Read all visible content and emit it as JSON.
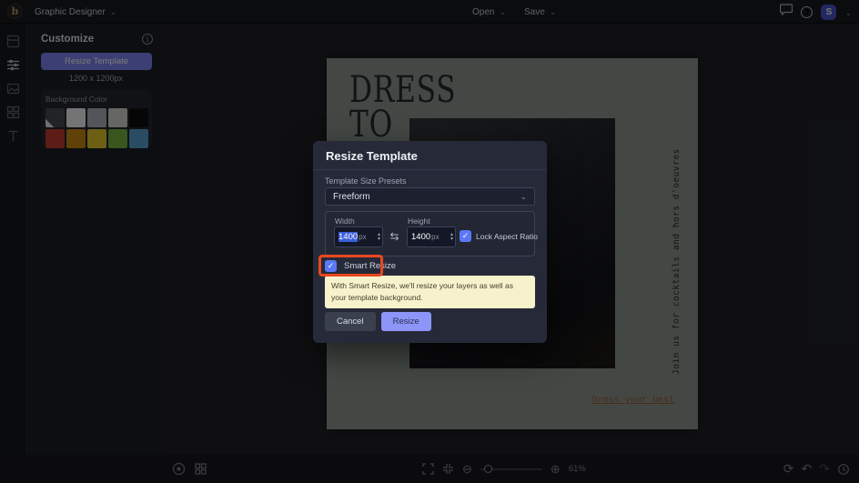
{
  "topbar": {
    "app_menu": "Graphic Designer",
    "open_label": "Open",
    "save_label": "Save",
    "avatar_initial": "S"
  },
  "sidebar": {
    "items": [
      "templates",
      "customize",
      "image-manager",
      "graphics",
      "text"
    ]
  },
  "panel": {
    "title": "Customize",
    "resize_button": "Resize Template",
    "dimensions": "1200 x 1200px",
    "background_color_label": "Background Color",
    "swatches": [
      "transparent",
      "#f2f2f2",
      "#aeb4ba",
      "#d6d6ce",
      "#0d0d0d",
      "#c23b2e",
      "#c98a12",
      "#e3c82a",
      "#78b440",
      "#58a0d0"
    ]
  },
  "canvas": {
    "heading_line1": "DRESS",
    "heading_line2": "TO",
    "vertical_text": "Join us for cocktails and hors d'oeuvres",
    "footer_text": "Dress your best"
  },
  "modal": {
    "title": "Resize Template",
    "presets_label": "Template Size Presets",
    "preset_value": "Freeform",
    "width_label": "Width",
    "height_label": "Height",
    "width_value": "1400",
    "height_value": "1400",
    "unit": "px",
    "lock_label": "Lock Aspect Ratio",
    "smart_resize_label": "Smart Resize",
    "info_text": "With Smart Resize, we'll resize your layers as well as your template background.",
    "cancel": "Cancel",
    "resize": "Resize"
  },
  "bottombar": {
    "zoom_percent": "61%"
  },
  "colors": {
    "accent_purple": "#8d95f8",
    "checkbox_blue": "#5b79f7",
    "highlight_red": "#e8481f",
    "info_yellow": "#f8f2cc",
    "modal_bg": "#262a38",
    "canvas_bg": "#8d968e"
  }
}
